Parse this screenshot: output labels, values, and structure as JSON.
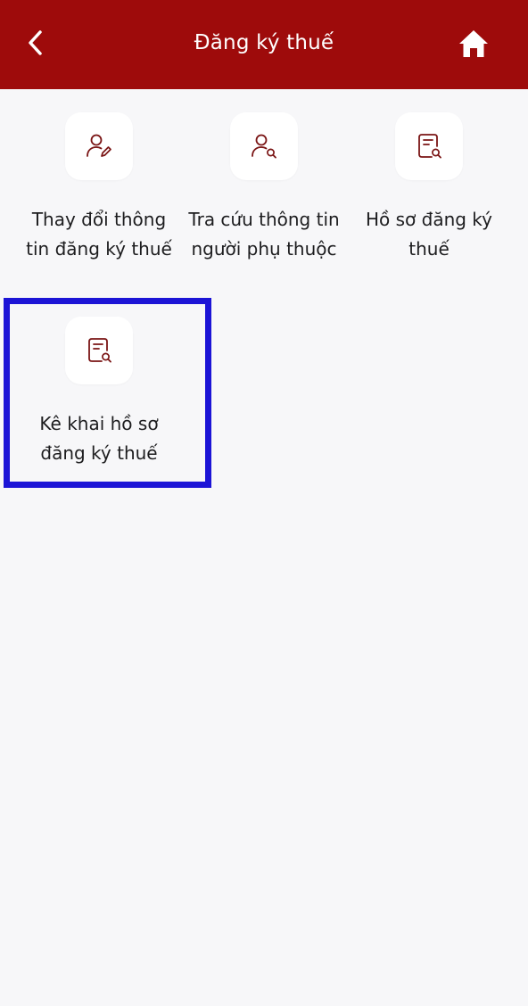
{
  "header": {
    "title": "Đăng ký thuế",
    "back_icon": "chevron-left-icon",
    "home_icon": "home-icon",
    "background_color": "#9e0b0b"
  },
  "tiles": [
    {
      "label": "Thay đổi thông tin đăng ký thuế",
      "icon": "user-edit-icon"
    },
    {
      "label": "Tra cứu thông tin người phụ thuộc",
      "icon": "user-search-icon"
    },
    {
      "label": "Hồ sơ đăng ký thuế",
      "icon": "document-search-icon"
    },
    {
      "label": "Kê khai hồ sơ đăng ký thuế",
      "icon": "document-search-icon",
      "highlighted": true
    }
  ],
  "colors": {
    "icon_stroke": "#7a1414",
    "highlight_border": "#1c14d6",
    "page_background": "#f7f7f9"
  }
}
